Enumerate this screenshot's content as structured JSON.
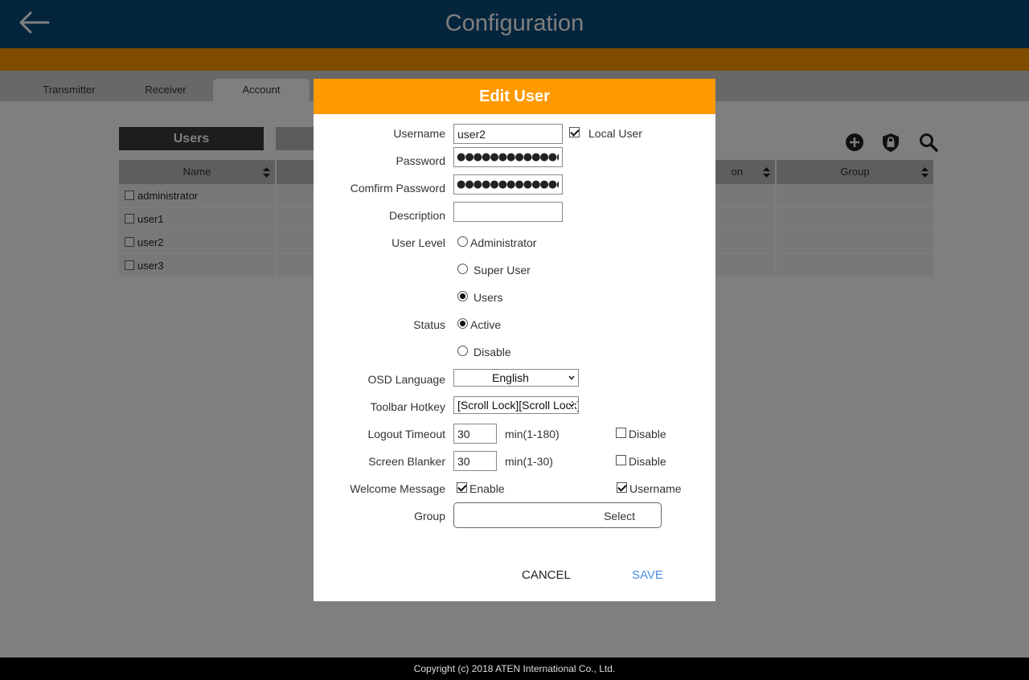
{
  "header": {
    "title": "Configuration"
  },
  "tabs": [
    {
      "label": "Transmitter"
    },
    {
      "label": "Receiver"
    },
    {
      "label": "Account"
    }
  ],
  "sub_tabs": {
    "users": "Users"
  },
  "toolbar_icons": [
    "add-icon",
    "lock-icon",
    "search-icon"
  ],
  "table": {
    "columns": [
      "Name",
      "",
      "",
      "on",
      "Group"
    ],
    "rows": [
      {
        "name": "administrator"
      },
      {
        "name": "user1"
      },
      {
        "name": "user2"
      },
      {
        "name": "user3"
      }
    ]
  },
  "footer": {
    "copyright": "Copyright (c) 2018 ATEN International Co., Ltd."
  },
  "dialog": {
    "title": "Edit User",
    "username": {
      "label": "Username",
      "value": "user2"
    },
    "local_user": {
      "label": "Local User",
      "checked": true
    },
    "password": {
      "label": "Password",
      "value": "●●●●●●●●●●●●●●●●"
    },
    "confirm_password": {
      "label": "Comfirm Password",
      "value": "●●●●●●●●●●●●●●●●"
    },
    "description": {
      "label": "Description",
      "value": ""
    },
    "user_level": {
      "label": "User Level",
      "options": [
        "Administrator",
        "Super User",
        "Users"
      ],
      "selected": "Users"
    },
    "status": {
      "label": "Status",
      "options": [
        "Active",
        "Disable"
      ],
      "selected": "Active"
    },
    "osd_language": {
      "label": "OSD Language",
      "value": "English"
    },
    "toolbar_hotkey": {
      "label": "Toolbar Hotkey",
      "value": "[Scroll Lock][Scroll Lock]"
    },
    "logout_timeout": {
      "label": "Logout Timeout",
      "value": "30",
      "unit": "min(1-180)",
      "disable_label": "Disable",
      "disable_checked": false
    },
    "screen_blanker": {
      "label": "Screen Blanker",
      "value": "30",
      "unit": "min(1-30)",
      "disable_label": "Disable",
      "disable_checked": false
    },
    "welcome_message": {
      "label": "Welcome Message",
      "enable_label": "Enable",
      "enable_checked": true,
      "username_label": "Username",
      "username_checked": true
    },
    "group": {
      "label": "Group",
      "button_label": "Select"
    },
    "cancel_label": "CANCEL",
    "save_label": "SAVE"
  },
  "colors": {
    "header_bg": "#0a4a7a",
    "accent_orange": "#ff9900",
    "save_blue": "#4a90e2"
  }
}
